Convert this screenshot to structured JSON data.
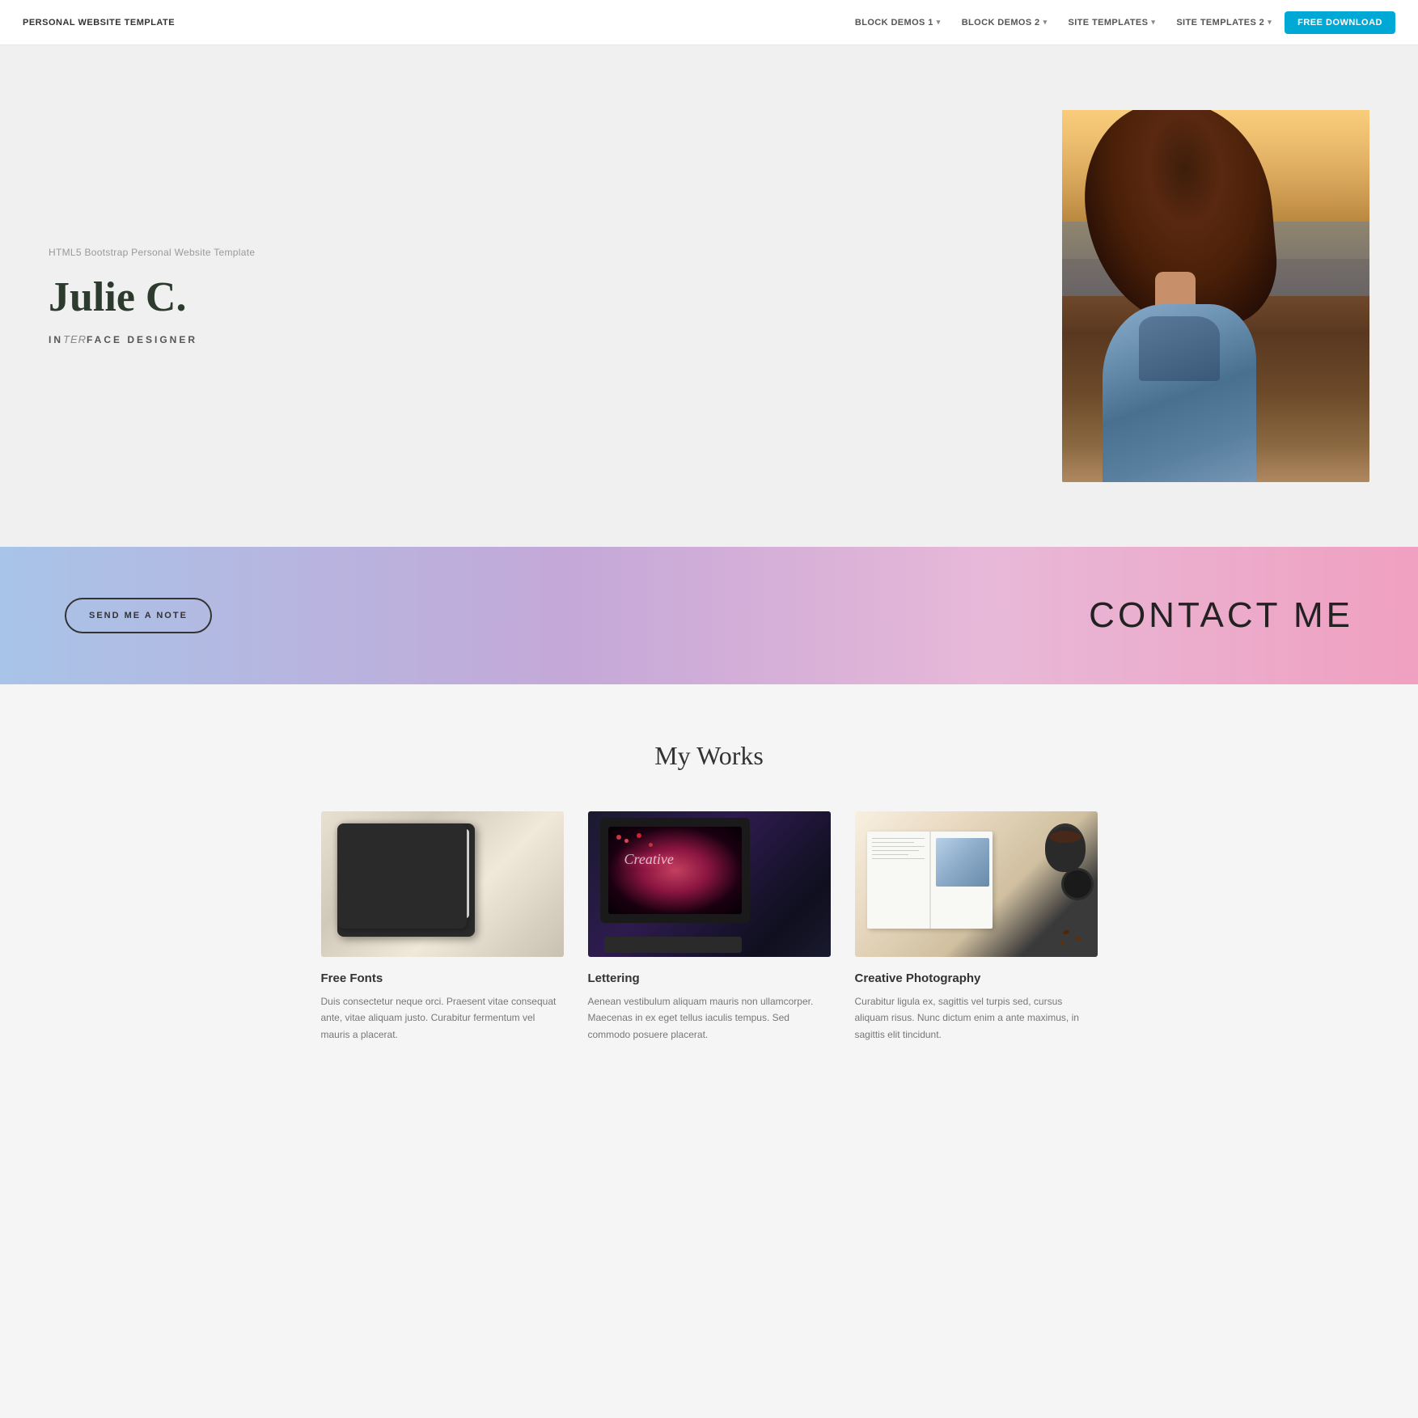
{
  "navbar": {
    "brand": "PERSONAL WEBSITE TEMPLATE",
    "links": [
      {
        "label": "BLOCK DEMOS 1",
        "has_dropdown": true
      },
      {
        "label": "BLOCK DEMOS 2",
        "has_dropdown": true
      },
      {
        "label": "SITE TEMPLATES",
        "has_dropdown": true
      },
      {
        "label": "SITE TEMPLATES 2",
        "has_dropdown": true
      }
    ],
    "cta_label": "FREE DOWNLOAD"
  },
  "hero": {
    "subtitle": "HTML5 Bootstrap Personal Website Template",
    "name": "Julie C.",
    "role_prefix": "IN",
    "role_italic": "TER",
    "role_suffix": "FACE DESIGNER"
  },
  "contact": {
    "button_label": "SEND ME A NOTE",
    "heading": "CONTACT ME"
  },
  "works": {
    "section_title": "My Works",
    "items": [
      {
        "title": "Free Fonts",
        "description": "Duis consectetur neque orci. Praesent vitae consequat ante, vitae aliquam justo. Curabitur fermentum vel mauris a placerat."
      },
      {
        "title": "Lettering",
        "description": "Aenean vestibulum aliquam mauris non ullamcorper. Maecenas in ex eget tellus iaculis tempus. Sed commodo posuere placerat."
      },
      {
        "title": "Creative Photography",
        "description": "Curabitur ligula ex, sagittis vel turpis sed, cursus aliquam risus. Nunc dictum enim a ante maximus, in sagittis elit tincidunt."
      }
    ]
  }
}
